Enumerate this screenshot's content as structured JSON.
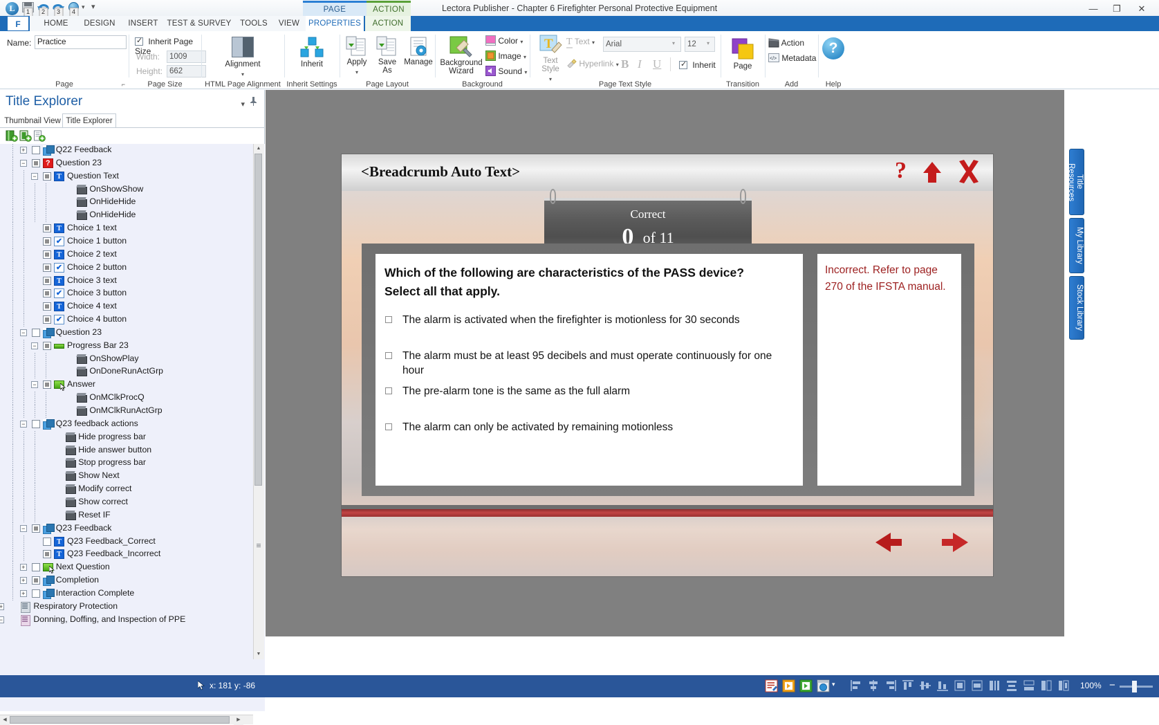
{
  "titlebar": {
    "app_title": "Lectora Publisher - Chapter 6 Firefighter Personal Protective Equipment",
    "quick_access": [
      {
        "name": "save",
        "badge": "1"
      },
      {
        "name": "undo",
        "badge": "2"
      },
      {
        "name": "redo",
        "badge": "3"
      },
      {
        "name": "preview",
        "badge": "4"
      }
    ],
    "qat_more": "▾",
    "window_minimize": "—",
    "window_restore": "❐",
    "window_close": "✕",
    "help_glyph": "?",
    "help_caret": "▾"
  },
  "context_tabs": [
    {
      "label": "PAGE",
      "accent": "#2a7fd4"
    },
    {
      "label": "ACTION",
      "accent": "#5aa038"
    }
  ],
  "ribbon_tabs": [
    {
      "label": "F",
      "active": false
    },
    {
      "label": "HOME",
      "active": false
    },
    {
      "label": "DESIGN",
      "active": false
    },
    {
      "label": "INSERT",
      "active": false
    },
    {
      "label": "TEST & SURVEY",
      "active": false
    },
    {
      "label": "TOOLS",
      "active": false
    },
    {
      "label": "VIEW",
      "active": false
    },
    {
      "label": "PROPERTIES",
      "active": true
    },
    {
      "label": "ACTION",
      "active": false
    }
  ],
  "ribbon": {
    "page_group": {
      "label": "Page",
      "name_label": "Name:",
      "name_value": "Practice",
      "dialog_launcher": "⌐"
    },
    "page_size_group": {
      "label": "Page Size",
      "inherit_checkbox_label": "Inherit Page Size",
      "inherit_checked": true,
      "width_label": "Width:",
      "width_value": "1009",
      "height_label": "Height:",
      "height_value": "662"
    },
    "alignment_group": {
      "label": "HTML Page Alignment",
      "button_label": "Alignment",
      "caret": "▾"
    },
    "inherit_group": {
      "label": "Inherit Settings",
      "button_label": "Inherit"
    },
    "page_layout_group": {
      "label": "Page Layout",
      "apply_label": "Apply",
      "apply_caret": "▾",
      "save_as_label": "Save\nAs",
      "save_as_line1": "Save",
      "save_as_line2": "As",
      "manage_label": "Manage"
    },
    "background_group": {
      "label": "Background",
      "wizard_line1": "Background",
      "wizard_line2": "Wizard",
      "color_label": "Color",
      "image_label": "Image",
      "sound_label": "Sound",
      "caret": "▾"
    },
    "text_style_group": {
      "label": "Page Text Style",
      "text_style_line1": "Text",
      "text_style_line2": "Style",
      "text_label": "Text",
      "hyperlink_label": "Hyperlink",
      "font_value": "Arial",
      "font_size_value": "12",
      "bold_label": "B",
      "italic_label": "I",
      "underline_label": "U",
      "inherit_label": "Inherit",
      "inherit_checked": true,
      "caret": "▾"
    },
    "transition_group": {
      "label": "Transition",
      "button_label": "Page"
    },
    "add_group": {
      "label": "Add",
      "action_label": "Action",
      "metadata_label": "Metadata"
    },
    "help_group": {
      "label": "Help",
      "button_glyph": "?"
    }
  },
  "left_panel": {
    "title": "Title Explorer",
    "collapse_caret": "▾",
    "pin_glyph": "📌",
    "tabs": [
      {
        "label": "Thumbnail View",
        "active": false
      },
      {
        "label": "Title Explorer",
        "active": true
      }
    ],
    "toolbar_icons": [
      "add-chapter-icon",
      "add-section-icon",
      "add-page-icon"
    ],
    "tree": [
      {
        "label": "Q22 Feedback",
        "depth": 4,
        "expander": "+",
        "vis": "empty",
        "icon": "group"
      },
      {
        "label": "Question 23",
        "depth": 4,
        "expander": "−",
        "vis": "filled",
        "icon": "question"
      },
      {
        "label": "Question Text",
        "depth": 5,
        "expander": "−",
        "vis": "filled",
        "icon": "text"
      },
      {
        "label": "OnShowShow",
        "depth": 7,
        "expander": "",
        "vis": "none",
        "icon": "action"
      },
      {
        "label": "OnHideHide",
        "depth": 7,
        "expander": "",
        "vis": "none",
        "icon": "action"
      },
      {
        "label": "OnHideHide",
        "depth": 7,
        "expander": "",
        "vis": "none",
        "icon": "action"
      },
      {
        "label": "Choice 1 text",
        "depth": 5,
        "expander": "",
        "vis": "filled",
        "icon": "text"
      },
      {
        "label": "Choice 1 button",
        "depth": 5,
        "expander": "",
        "vis": "filled",
        "icon": "check"
      },
      {
        "label": "Choice 2 text",
        "depth": 5,
        "expander": "",
        "vis": "filled",
        "icon": "text"
      },
      {
        "label": "Choice 2 button",
        "depth": 5,
        "expander": "",
        "vis": "filled",
        "icon": "check"
      },
      {
        "label": "Choice 3 text",
        "depth": 5,
        "expander": "",
        "vis": "filled",
        "icon": "text"
      },
      {
        "label": "Choice 3 button",
        "depth": 5,
        "expander": "",
        "vis": "filled",
        "icon": "check"
      },
      {
        "label": "Choice 4 text",
        "depth": 5,
        "expander": "",
        "vis": "filled",
        "icon": "text"
      },
      {
        "label": "Choice 4 button",
        "depth": 5,
        "expander": "",
        "vis": "filled",
        "icon": "check"
      },
      {
        "label": "Question 23",
        "depth": 4,
        "expander": "−",
        "vis": "empty",
        "icon": "group"
      },
      {
        "label": "Progress Bar 23",
        "depth": 5,
        "expander": "−",
        "vis": "filled",
        "icon": "progressbar"
      },
      {
        "label": "OnShowPlay",
        "depth": 7,
        "expander": "",
        "vis": "none",
        "icon": "action"
      },
      {
        "label": "OnDoneRunActGrp",
        "depth": 7,
        "expander": "",
        "vis": "none",
        "icon": "action"
      },
      {
        "label": "Answer",
        "depth": 5,
        "expander": "−",
        "vis": "filled",
        "icon": "button",
        "cursor": true
      },
      {
        "label": "OnMClkProcQ",
        "depth": 7,
        "expander": "",
        "vis": "none",
        "icon": "action"
      },
      {
        "label": "OnMClkRunActGrp",
        "depth": 7,
        "expander": "",
        "vis": "none",
        "icon": "action"
      },
      {
        "label": "Q23 feedback actions",
        "depth": 4,
        "expander": "−",
        "vis": "empty",
        "icon": "group"
      },
      {
        "label": "Hide progress bar",
        "depth": 6,
        "expander": "",
        "vis": "none",
        "icon": "action"
      },
      {
        "label": "Hide answer button",
        "depth": 6,
        "expander": "",
        "vis": "none",
        "icon": "action"
      },
      {
        "label": "Stop progress bar",
        "depth": 6,
        "expander": "",
        "vis": "none",
        "icon": "action"
      },
      {
        "label": "Show Next",
        "depth": 6,
        "expander": "",
        "vis": "none",
        "icon": "action"
      },
      {
        "label": "Modify correct",
        "depth": 6,
        "expander": "",
        "vis": "none",
        "icon": "action"
      },
      {
        "label": "Show correct",
        "depth": 6,
        "expander": "",
        "vis": "none",
        "icon": "action"
      },
      {
        "label": "Reset IF",
        "depth": 6,
        "expander": "",
        "vis": "none",
        "icon": "action"
      },
      {
        "label": "Q23 Feedback",
        "depth": 4,
        "expander": "−",
        "vis": "filled",
        "icon": "group"
      },
      {
        "label": "Q23 Feedback_Correct",
        "depth": 5,
        "expander": "",
        "vis": "empty",
        "icon": "text"
      },
      {
        "label": "Q23 Feedback_Incorrect",
        "depth": 5,
        "expander": "",
        "vis": "filled",
        "icon": "text"
      },
      {
        "label": "Next Question",
        "depth": 4,
        "expander": "+",
        "vis": "empty",
        "icon": "button",
        "cursor": true
      },
      {
        "label": "Completion",
        "depth": 4,
        "expander": "+",
        "vis": "filled",
        "icon": "group"
      },
      {
        "label": "Interaction Complete",
        "depth": 4,
        "expander": "+",
        "vis": "empty",
        "icon": "group"
      },
      {
        "label": "Respiratory Protection",
        "depth": 2,
        "expander": "+",
        "vis": "none",
        "icon": "chapter"
      },
      {
        "label": "Donning, Doffing, and Inspection of PPE",
        "depth": 2,
        "expander": "−",
        "vis": "none",
        "icon": "chapter-open"
      }
    ]
  },
  "stage": {
    "breadcrumb": "<Breadcrumb Auto Text>",
    "header_icons": [
      {
        "name": "help-question-icon",
        "glyph": "?"
      },
      {
        "name": "up-arrow-icon",
        "glyph": "⬆"
      },
      {
        "name": "close-x-icon",
        "glyph": "✗"
      }
    ],
    "score_sign": {
      "caption": "Correct",
      "score": "0",
      "of_label": "of 11"
    },
    "question": {
      "prompt_line1": "Which of the following are characteristics of the PASS device?",
      "prompt_line2": "Select all that apply.",
      "choices": [
        {
          "label": "The alarm is activated when the firefighter is motionless for 30 seconds",
          "checked": false
        },
        {
          "label": "The alarm must be at least 95 decibels and must operate continuously for one hour",
          "checked": false
        },
        {
          "label": "The pre-alarm tone is the same as the full alarm",
          "checked": false
        },
        {
          "label": "The alarm can only be activated by remaining motionless",
          "checked": false
        }
      ]
    },
    "feedback": {
      "text": "Incorrect. Refer to page 270 of the IFSTA manual.",
      "color": "#9c1f1f"
    },
    "nav": [
      {
        "name": "previous-page-arrow",
        "glyph": "◀"
      },
      {
        "name": "next-page-arrow",
        "glyph": "▶"
      }
    ]
  },
  "right_dock": {
    "tabs": [
      {
        "label": "Title Resources"
      },
      {
        "label": "My Library"
      },
      {
        "label": "Stock Library"
      }
    ]
  },
  "statusbar": {
    "cursor_label": "x: 181  y: -86",
    "cursor_x": "181",
    "cursor_y": "-86",
    "mode_icons": [
      "edit-mode-icon",
      "preview-page-icon",
      "run-mode-icon",
      "browser-preview-icon"
    ],
    "mode_caret": "▾",
    "align_icons": [
      "align-left-icon",
      "align-center-horizontal-icon",
      "align-right-icon",
      "align-top-icon",
      "align-middle-vertical-icon",
      "align-bottom-icon",
      "size-same-width-icon",
      "size-same-height-icon",
      "size-same-both-icon",
      "distribute-vertical-icon",
      "distribute-horizontal-icon",
      "group-icon",
      "ungroup-icon"
    ],
    "zoom_label": "100%",
    "zoom_out": "−",
    "zoom_in": "+"
  }
}
